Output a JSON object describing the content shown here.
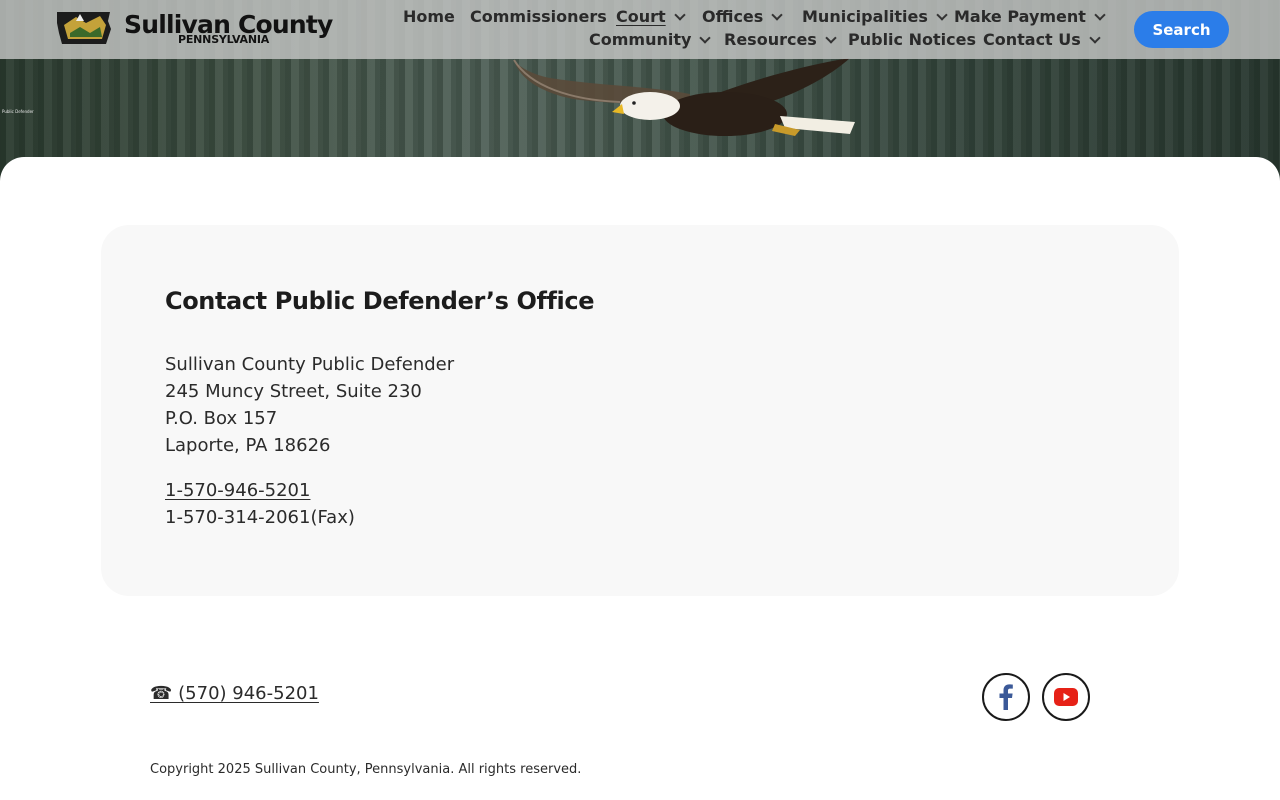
{
  "header": {
    "brand_name": "Sullivan County",
    "brand_sub": "PENNSYLVANIA",
    "search_label": "Search",
    "nav": [
      {
        "label": "Home",
        "has_dropdown": false
      },
      {
        "label": "Commissioners",
        "has_dropdown": false
      },
      {
        "label": "Court",
        "has_dropdown": true,
        "active": true
      },
      {
        "label": "Offices",
        "has_dropdown": true
      },
      {
        "label": "Municipalities",
        "has_dropdown": true
      },
      {
        "label": "Make Payment",
        "has_dropdown": true
      },
      {
        "label": "Community",
        "has_dropdown": true
      },
      {
        "label": "Resources",
        "has_dropdown": true
      },
      {
        "label": "Public Notices",
        "has_dropdown": false
      },
      {
        "label": "Contact Us",
        "has_dropdown": true
      }
    ]
  },
  "hero": {
    "tiny_text": "Public Defender"
  },
  "card": {
    "title": "Contact Public Defender’s Office",
    "address_lines": [
      "Sullivan County Public Defender",
      "245 Muncy Street, Suite 230",
      "P.O. Box 157",
      "Laporte, PA 18626"
    ],
    "phone": "1-570-946-5201",
    "fax": "1-570-314-2061(Fax)"
  },
  "footer": {
    "phone": "☎ (570) 946-5201",
    "copyright": "Copyright 2025 Sullivan County, Pennsylvania. All rights reserved.",
    "social": [
      "facebook-icon",
      "youtube-icon"
    ]
  },
  "colors": {
    "accent": "#2b7de9",
    "facebook": "#3b5998",
    "youtube": "#e62117"
  }
}
